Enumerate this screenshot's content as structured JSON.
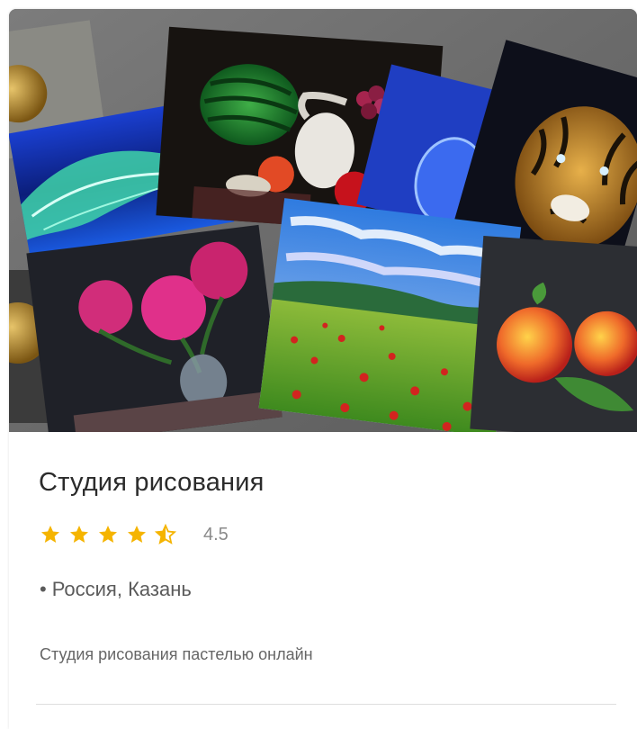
{
  "card": {
    "title": "Студия рисования",
    "rating": {
      "value": 4.5,
      "label": "4.5",
      "max": 5,
      "star_color": "#f5b400"
    },
    "location": {
      "bullet": "•",
      "text": "Россия, Казань"
    },
    "description": "Студия рисования пастелью онлайн",
    "image_icon": "pastel-paintings-collage"
  }
}
